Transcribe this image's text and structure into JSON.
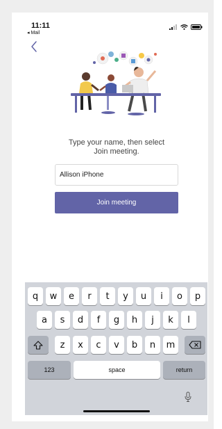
{
  "status_bar": {
    "time": "11:11",
    "back_app": "◂ Mail"
  },
  "prompt": {
    "line1": "Type your name, then select",
    "line2": "Join meeting."
  },
  "name_field": {
    "value": "Allison iPhone"
  },
  "join_button": {
    "label": "Join meeting"
  },
  "keyboard": {
    "row1": [
      "q",
      "w",
      "e",
      "r",
      "t",
      "y",
      "u",
      "i",
      "o",
      "p"
    ],
    "row2": [
      "a",
      "s",
      "d",
      "f",
      "g",
      "h",
      "j",
      "k",
      "l"
    ],
    "row3": [
      "z",
      "x",
      "c",
      "v",
      "b",
      "n",
      "m"
    ],
    "numbers_label": "123",
    "space_label": "space",
    "return_label": "return",
    "shift_icon": "shift-icon",
    "backspace_icon": "backspace-icon",
    "mic_icon": "microphone-icon"
  },
  "colors": {
    "accent": "#6264a7",
    "keyboard_bg": "#d1d4da",
    "special_key": "#acb1ba"
  }
}
